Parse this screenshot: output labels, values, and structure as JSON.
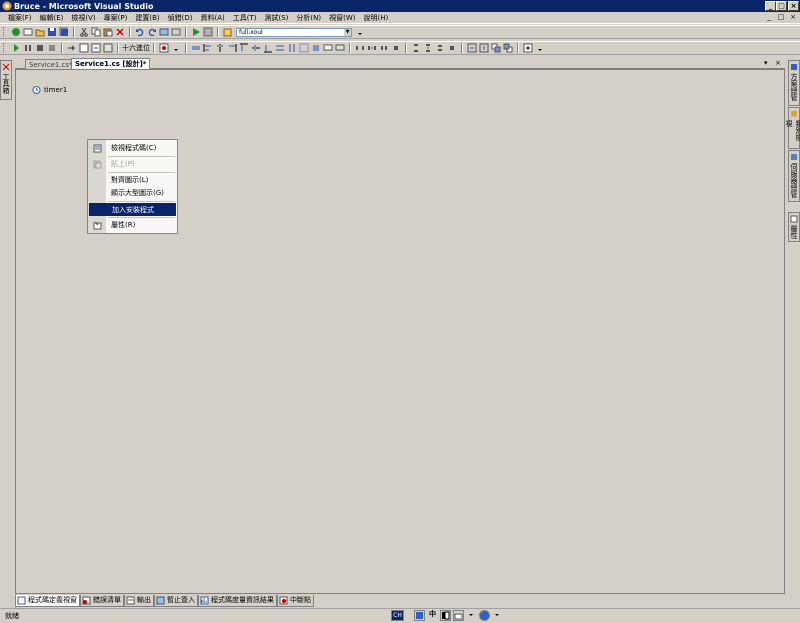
{
  "window": {
    "title": "Bruce - Microsoft Visual Studio",
    "controls": {
      "minimize": "_",
      "maximize": "□",
      "close": "×"
    }
  },
  "menu": {
    "items": [
      "檔案(F)",
      "編輯(E)",
      "檢視(V)",
      "專案(P)",
      "建置(B)",
      "偵錯(D)",
      "資料(A)",
      "工具(T)",
      "測試(S)",
      "分析(N)",
      "視窗(W)",
      "說明(H)"
    ]
  },
  "toolbar": {
    "config_combo": "full.xoul",
    "hex_label": "十六進位"
  },
  "tabs": [
    {
      "label": "Service1.cs*"
    },
    {
      "label": "Service1.cs [設計]*"
    }
  ],
  "tab_controls": {
    "dropdown": "▾",
    "close": "×"
  },
  "left_sidebar": {
    "toolbox": "工具箱"
  },
  "right_sidebar": {
    "items": [
      "方案總管",
      "類別檢視",
      "伺服器總管",
      "屬性"
    ]
  },
  "designer": {
    "component_name": "timer1"
  },
  "context_menu": {
    "items": [
      {
        "label": "檢視程式碼(C)",
        "state": "normal"
      },
      {
        "label": "貼上(P)",
        "state": "disabled"
      },
      {
        "label": "對齊圖示(L)",
        "state": "normal"
      },
      {
        "label": "顯示大型圖示(G)",
        "state": "normal"
      },
      {
        "label": "加入安裝程式",
        "state": "highlighted"
      },
      {
        "label": "屬性(R)",
        "state": "normal"
      }
    ]
  },
  "bottom_tabs": [
    {
      "label": "程式碼定義視窗",
      "icon": "code-definition-icon"
    },
    {
      "label": "錯誤清單",
      "icon": "error-list-icon"
    },
    {
      "label": "輸出",
      "icon": "output-icon"
    },
    {
      "label": "暫止簽入",
      "icon": "pending-checkin-icon"
    },
    {
      "label": "程式碼度量資訊結果",
      "icon": "code-metrics-icon"
    },
    {
      "label": "中斷點",
      "icon": "breakpoint-icon"
    }
  ],
  "status": {
    "text": "就緒",
    "ime": {
      "mode": "CH",
      "char": "中"
    }
  },
  "colors": {
    "titlebar": "#0a246a",
    "highlight": "#0a246a",
    "chrome": "#d4d0c8"
  }
}
